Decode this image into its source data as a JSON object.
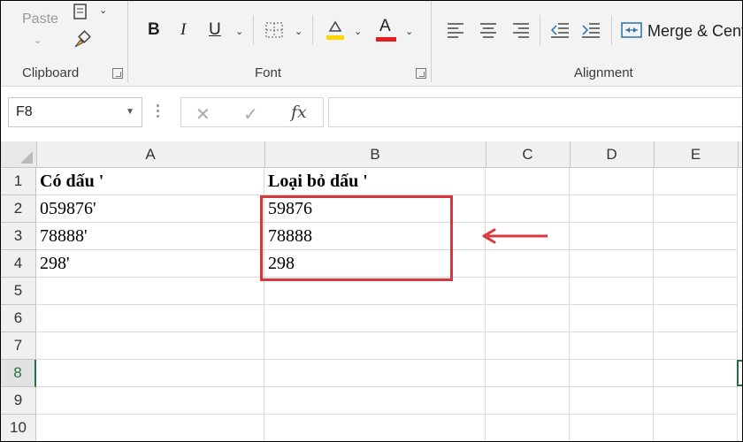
{
  "ribbon": {
    "clipboard": {
      "paste_label": "Paste",
      "group_label": "Clipboard"
    },
    "font": {
      "group_label": "Font",
      "bold": "B",
      "italic": "I",
      "underline": "U",
      "font_color": "A"
    },
    "alignment": {
      "group_label": "Alignment",
      "merge_label": "Merge & Cent"
    }
  },
  "formula_bar": {
    "name_box": "F8",
    "fx": "fx",
    "cancel_symbol": "✕",
    "enter_symbol": "✓",
    "formula": ""
  },
  "sheet": {
    "columns": [
      "A",
      "B",
      "C",
      "D",
      "E"
    ],
    "rows": [
      "1",
      "2",
      "3",
      "4",
      "5",
      "6",
      "7",
      "8",
      "9",
      "10"
    ],
    "active_row": "8",
    "cells": {
      "A1": "Có dấu '",
      "B1": "Loại bỏ dấu '",
      "A2": "059876'",
      "B2": "59876",
      "A3": "78888'",
      "B3": "78888",
      "A4": "298'",
      "B4": "298"
    }
  },
  "colors": {
    "highlight": "#d9363e",
    "excel_green": "#217346",
    "fill_color": "#ffd400",
    "font_color": "#e31c1c"
  }
}
